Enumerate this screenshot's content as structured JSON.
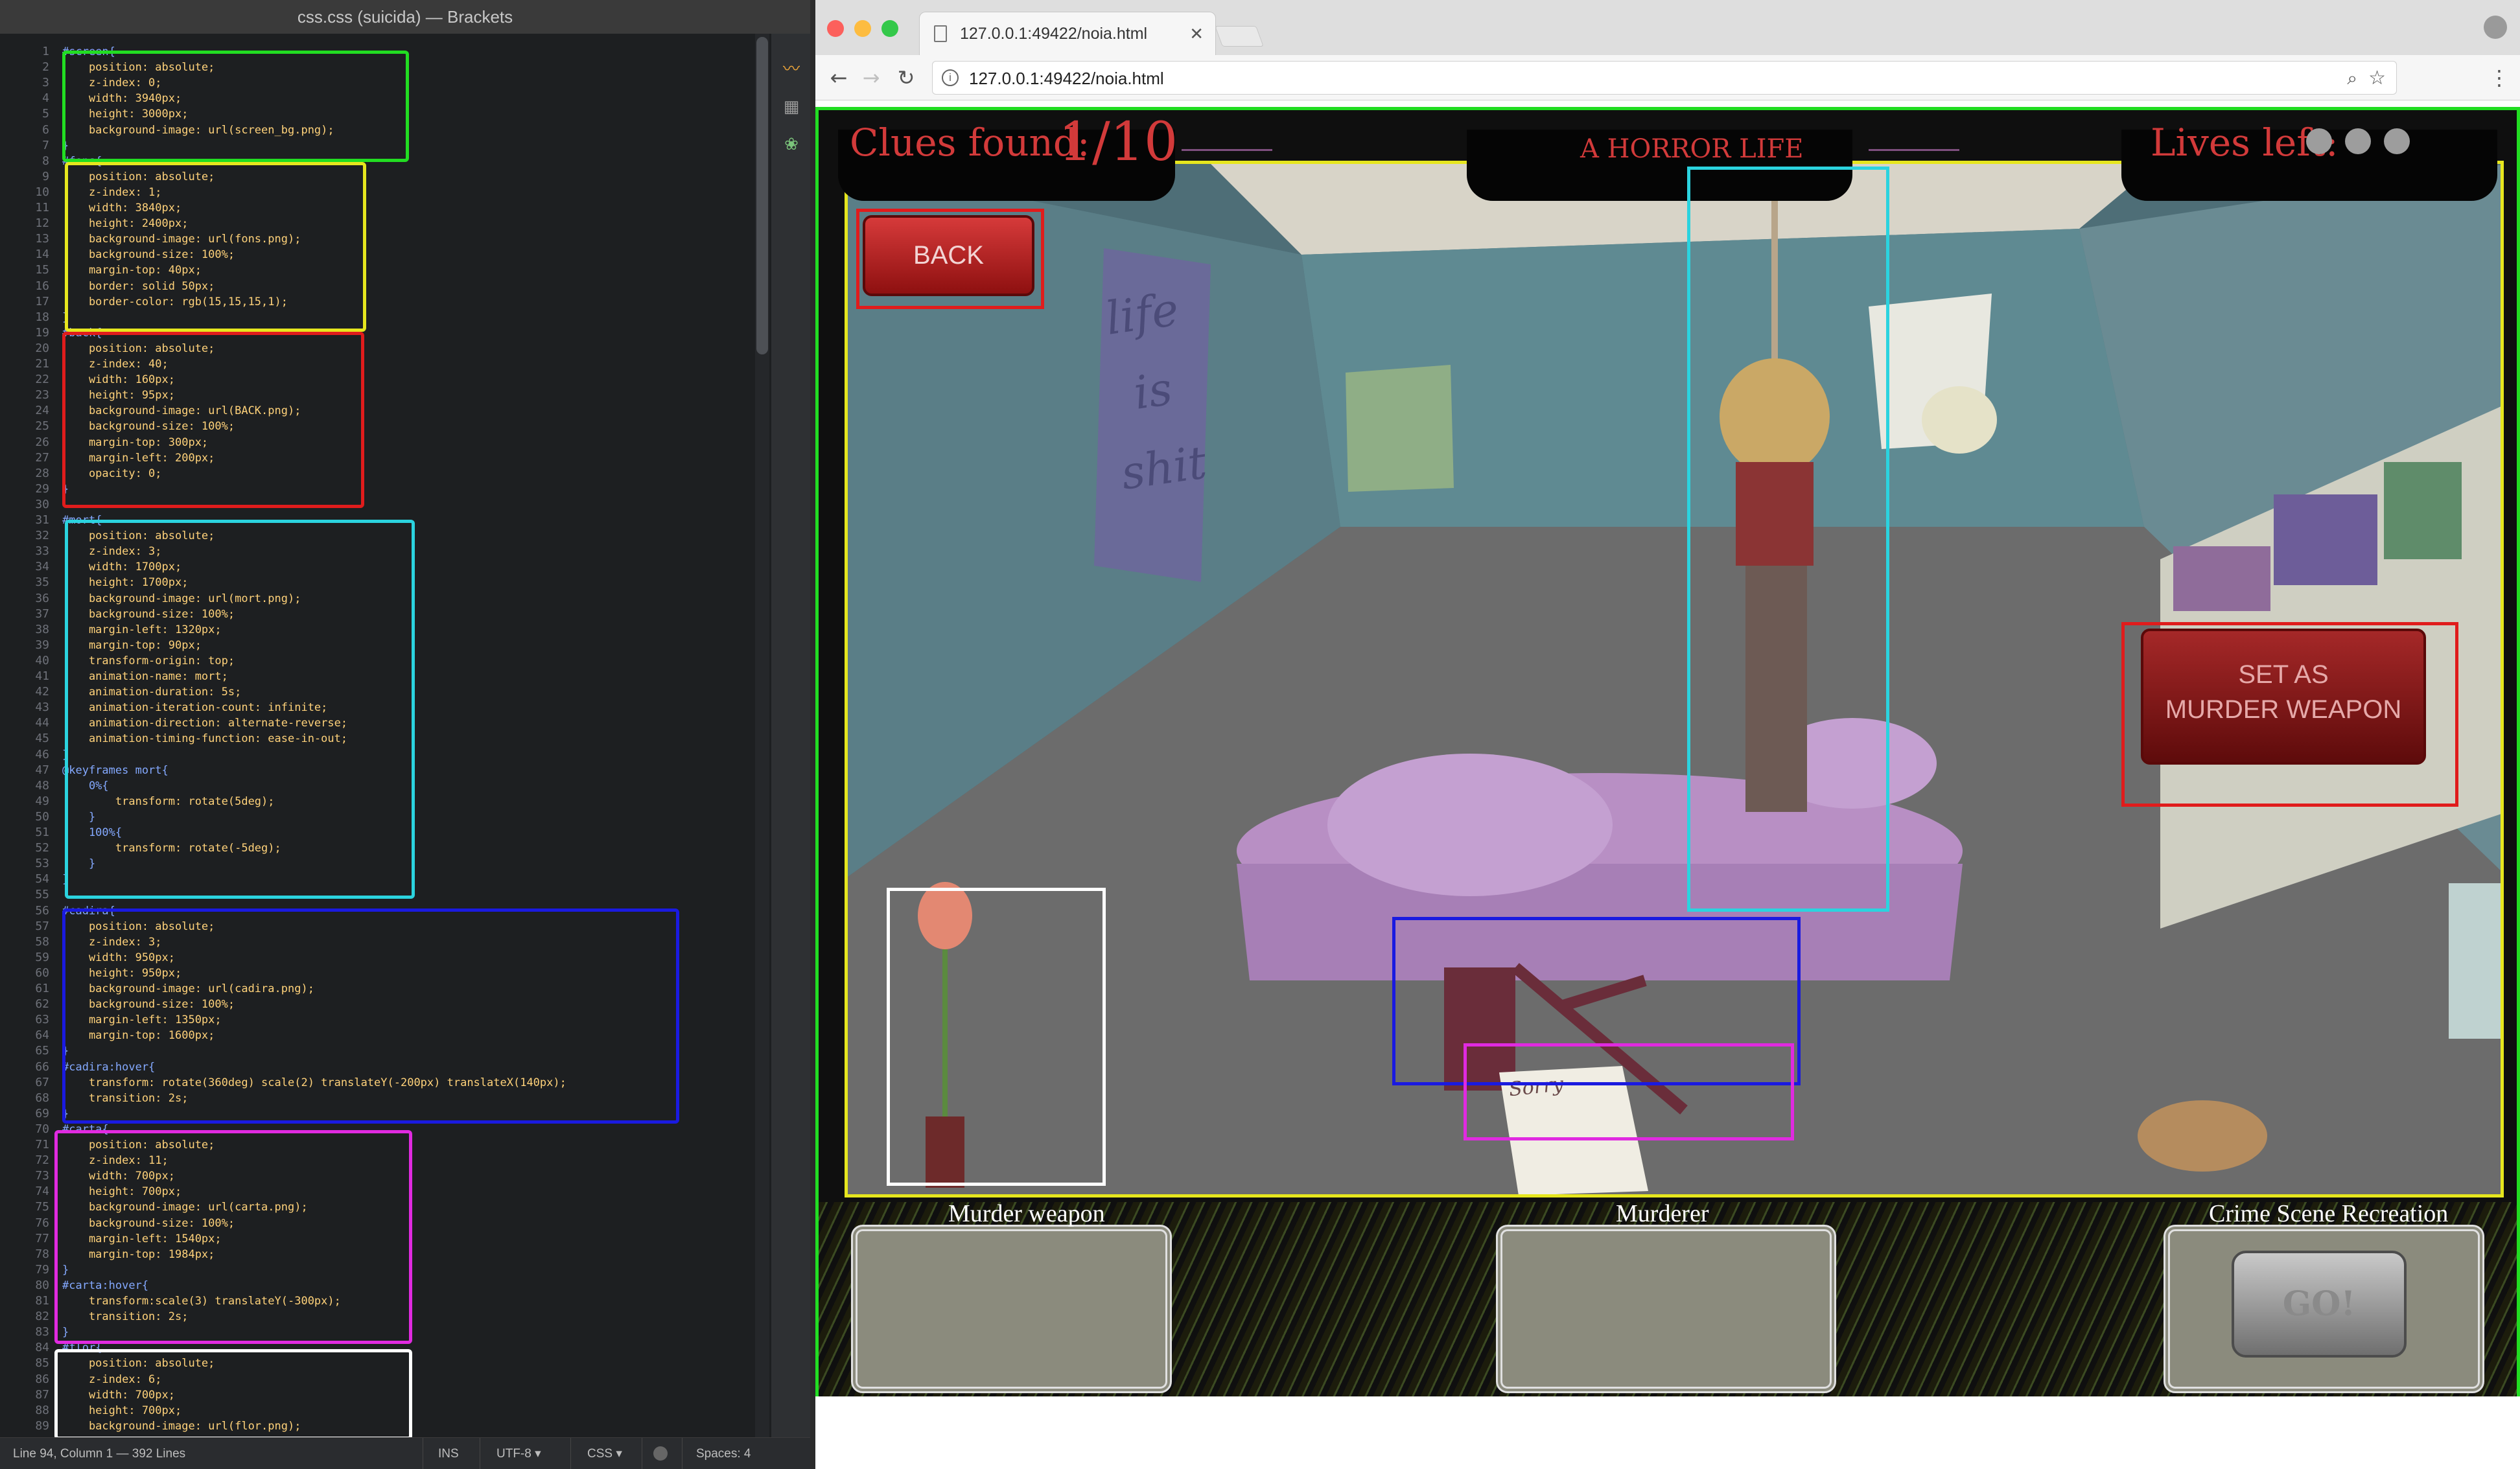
{
  "editor": {
    "window_title": "css.css (suicida) — Brackets",
    "status": {
      "position": "Line 94, Column 1 — 392 Lines",
      "mode": "INS",
      "encoding": "UTF-8 ▾",
      "language": "CSS ▾",
      "indent": "Spaces: 4"
    },
    "line_numbers": [
      "1",
      "2",
      "3",
      "4",
      "5",
      "6",
      "7",
      "8",
      "9",
      "10",
      "11",
      "12",
      "13",
      "14",
      "15",
      "16",
      "17",
      "18",
      "19",
      "20",
      "21",
      "22",
      "23",
      "24",
      "25",
      "26",
      "27",
      "28",
      "29",
      "30",
      "31",
      "32",
      "33",
      "34",
      "35",
      "36",
      "37",
      "38",
      "39",
      "40",
      "41",
      "42",
      "43",
      "44",
      "45",
      "46",
      "47",
      "48",
      "49",
      "50",
      "51",
      "52",
      "53",
      "54",
      "55",
      "56",
      "57",
      "58",
      "59",
      "60",
      "61",
      "62",
      "63",
      "64",
      "65",
      "66",
      "67",
      "68",
      "69",
      "70",
      "71",
      "72",
      "73",
      "74",
      "75",
      "76",
      "77",
      "78",
      "79",
      "80",
      "81",
      "82",
      "83",
      "84",
      "85",
      "86",
      "87",
      "88",
      "89"
    ],
    "code_lines": [
      "#screen{",
      "    position: absolute;",
      "    z-index: 0;",
      "    width: 3940px;",
      "    height: 3000px;",
      "    background-image: url(screen_bg.png);",
      "}",
      "#fons{",
      "    position: absolute;",
      "    z-index: 1;",
      "    width: 3840px;",
      "    height: 2400px;",
      "    background-image: url(fons.png);",
      "    background-size: 100%;",
      "    margin-top: 40px;",
      "    border: solid 50px;",
      "    border-color: rgb(15,15,15,1);",
      "}",
      "#back{",
      "    position: absolute;",
      "    z-index: 40;",
      "    width: 160px;",
      "    height: 95px;",
      "    background-image: url(BACK.png);",
      "    background-size: 100%;",
      "    margin-top: 300px;",
      "    margin-left: 200px;",
      "    opacity: 0;",
      "}",
      "",
      "#mort{",
      "    position: absolute;",
      "    z-index: 3;",
      "    width: 1700px;",
      "    height: 1700px;",
      "    background-image: url(mort.png);",
      "    background-size: 100%;",
      "    margin-left: 1320px;",
      "    margin-top: 90px;",
      "    transform-origin: top;",
      "    animation-name: mort;",
      "    animation-duration: 5s;",
      "    animation-iteration-count: infinite;",
      "    animation-direction: alternate-reverse;",
      "    animation-timing-function: ease-in-out;",
      "}",
      "@keyframes mort{",
      "    0%{",
      "        transform: rotate(5deg);",
      "    }",
      "    100%{",
      "        transform: rotate(-5deg);",
      "    }",
      "}",
      "",
      "#cadira{",
      "    position: absolute;",
      "    z-index: 3;",
      "    width: 950px;",
      "    height: 950px;",
      "    background-image: url(cadira.png);",
      "    background-size: 100%;",
      "    margin-left: 1350px;",
      "    margin-top: 1600px;",
      "}",
      "#cadira:hover{",
      "    transform: rotate(360deg) scale(2) translateY(-200px) translateX(140px);",
      "    transition: 2s;",
      "}",
      "#carta{",
      "    position: absolute;",
      "    z-index: 11;",
      "    width: 700px;",
      "    height: 700px;",
      "    background-image: url(carta.png);",
      "    background-size: 100%;",
      "    margin-left: 1540px;",
      "    margin-top: 1984px;",
      "}",
      "#carta:hover{",
      "    transform:scale(3) translateY(-300px);",
      "    transition: 2s;",
      "}",
      "#flor{",
      "    position: absolute;",
      "    z-index: 6;",
      "    width: 700px;",
      "    height: 700px;",
      "    background-image: url(flor.png);"
    ]
  },
  "browser": {
    "tab_title": "127.0.0.1:49422/noia.html",
    "url": "127.0.0.1:49422/noia.html"
  },
  "game": {
    "clues_label": "Clues found:",
    "clues_value": "1/10",
    "title": "A HORROR LIFE",
    "lives_label": "Lives left:",
    "back_label": "BACK",
    "set_weapon_line1": "SET AS",
    "set_weapon_line2": "MURDER WEAPON",
    "poster_text_1": "life",
    "poster_text_2": "is",
    "poster_text_3": "shit",
    "note_text": "Sorry",
    "murder_weapon_label": "Murder weapon",
    "murderer_label": "Murderer",
    "crime_scene_label": "Crime Scene Recreation",
    "go_label": "GO!"
  },
  "colors": {
    "box_screen": "#22dd22",
    "box_fons": "#e6e61e",
    "box_back": "#e01c1c",
    "box_mort": "#2bd3df",
    "box_cadira": "#1a1ae0",
    "box_carta": "#e02ae0",
    "box_flor": "#ffffff"
  }
}
